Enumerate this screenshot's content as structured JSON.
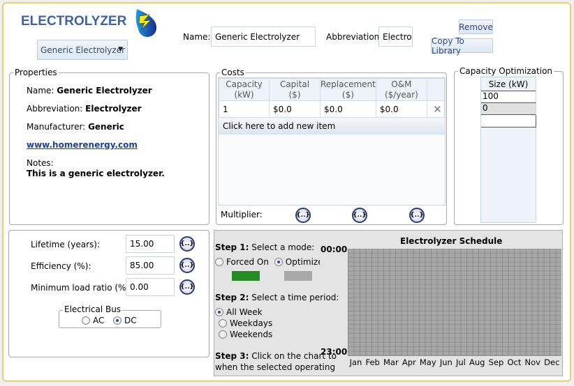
{
  "header": {
    "title": "ELECTROLYZER",
    "icon": "electrolyzer-drop-icon",
    "selector_value": "Generic Electrolyzer",
    "name_label": "Name:",
    "name_value": "Generic Electrolyzer",
    "abbreviation_label": "Abbreviation:",
    "abbreviation_value": "Electrolyzer",
    "remove_label": "Remove",
    "copy_label": "Copy To Library"
  },
  "properties": {
    "legend": "Properties",
    "name_label": "Name:",
    "name_value": "Generic Electrolyzer",
    "abbr_label": "Abbreviation:",
    "abbr_value": "Electrolyzer",
    "manufacturer_label": "Manufacturer:",
    "manufacturer_value": "Generic",
    "link": "www.homerenergy.com",
    "notes_label": "Notes:",
    "notes_value": "This is a generic electrolyzer."
  },
  "costs": {
    "legend": "Costs",
    "headers": [
      [
        "Capacity",
        "(kW)"
      ],
      [
        "Capital",
        "($)"
      ],
      [
        "Replacement",
        "($)"
      ],
      [
        "O&M",
        "($/year)"
      ]
    ],
    "rows": [
      [
        "1",
        "$0.0",
        "$0.0",
        "$0.0"
      ]
    ],
    "add_item": "Click here to add new item",
    "multiplier_label": "Multiplier:",
    "multiplier_button": "{..}"
  },
  "capacity_opt": {
    "legend": "Capacity Optimization",
    "header": "Size (kW)",
    "values": [
      "100",
      "0",
      ""
    ]
  },
  "params": {
    "lifetime_label": "Lifetime (years):",
    "lifetime_value": "15.00",
    "efficiency_label": "Efficiency (%):",
    "efficiency_value": "85.00",
    "minload_label": "Minimum load ratio (%):",
    "minload_value": "0.00",
    "fx": "{..}",
    "bus_legend": "Electrical Bus",
    "bus_ac": "AC",
    "bus_dc": "DC",
    "bus_selected": "DC"
  },
  "schedule": {
    "title": "Electrolyzer Schedule",
    "step1_b": "Step 1:",
    "step1": " Select a mode:",
    "forced_on": "Forced On",
    "optimized": "Optimized",
    "mode_selected": "Optimized",
    "forced_color": "#228b22",
    "optimized_color": "#a8a8a8",
    "step2_b": "Step 2:",
    "step2": " Select a time period:",
    "periods": [
      "All Week",
      "Weekdays",
      "Weekends"
    ],
    "period_selected": "All Week",
    "step3_b": "Step 3:",
    "step3": " Click on the chart to",
    "step3_line2": "when the selected operating",
    "hour_start": "00:00",
    "hour_end": "23:00",
    "months": [
      "Jan",
      "Feb",
      "Mar",
      "Apr",
      "May",
      "Jun",
      "Jul",
      "Aug",
      "Sep",
      "Oct",
      "Nov",
      "Dec"
    ]
  }
}
